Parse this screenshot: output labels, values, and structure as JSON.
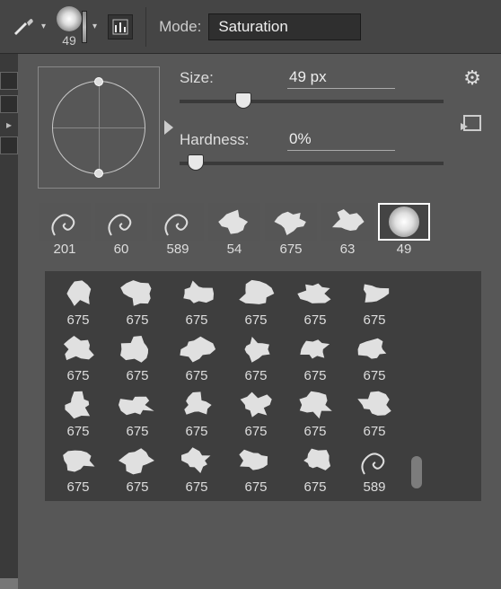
{
  "toolbar": {
    "brush_size_label": "49",
    "mode_label": "Mode:",
    "mode_value": "Saturation"
  },
  "settings": {
    "size_label": "Size:",
    "size_value": "49 px",
    "size_pos_pct": 21,
    "hardness_label": "Hardness:",
    "hardness_value": "0%",
    "hardness_pos_pct": 3
  },
  "history": [
    {
      "label": "201",
      "type": "swirl",
      "selected": false
    },
    {
      "label": "60",
      "type": "swirl",
      "selected": false
    },
    {
      "label": "589",
      "type": "swirl",
      "selected": false
    },
    {
      "label": "54",
      "type": "splat",
      "selected": false
    },
    {
      "label": "675",
      "type": "splat",
      "selected": false
    },
    {
      "label": "63",
      "type": "splat",
      "selected": false
    },
    {
      "label": "49",
      "type": "soft",
      "selected": true
    }
  ],
  "grid": [
    [
      {
        "label": "675",
        "type": "splat"
      },
      {
        "label": "675",
        "type": "splat"
      },
      {
        "label": "675",
        "type": "splat"
      },
      {
        "label": "675",
        "type": "splat"
      },
      {
        "label": "675",
        "type": "splat"
      },
      {
        "label": "675",
        "type": "splat"
      }
    ],
    [
      {
        "label": "675",
        "type": "splat"
      },
      {
        "label": "675",
        "type": "splat"
      },
      {
        "label": "675",
        "type": "splat"
      },
      {
        "label": "675",
        "type": "splat"
      },
      {
        "label": "675",
        "type": "splat"
      },
      {
        "label": "675",
        "type": "splat"
      }
    ],
    [
      {
        "label": "675",
        "type": "splat"
      },
      {
        "label": "675",
        "type": "splat"
      },
      {
        "label": "675",
        "type": "splat"
      },
      {
        "label": "675",
        "type": "splat"
      },
      {
        "label": "675",
        "type": "splat"
      },
      {
        "label": "675",
        "type": "splat"
      }
    ],
    [
      {
        "label": "675",
        "type": "splat"
      },
      {
        "label": "675",
        "type": "splat"
      },
      {
        "label": "675",
        "type": "splat"
      },
      {
        "label": "675",
        "type": "splat"
      },
      {
        "label": "675",
        "type": "splat"
      },
      {
        "label": "589",
        "type": "swirl"
      }
    ]
  ]
}
